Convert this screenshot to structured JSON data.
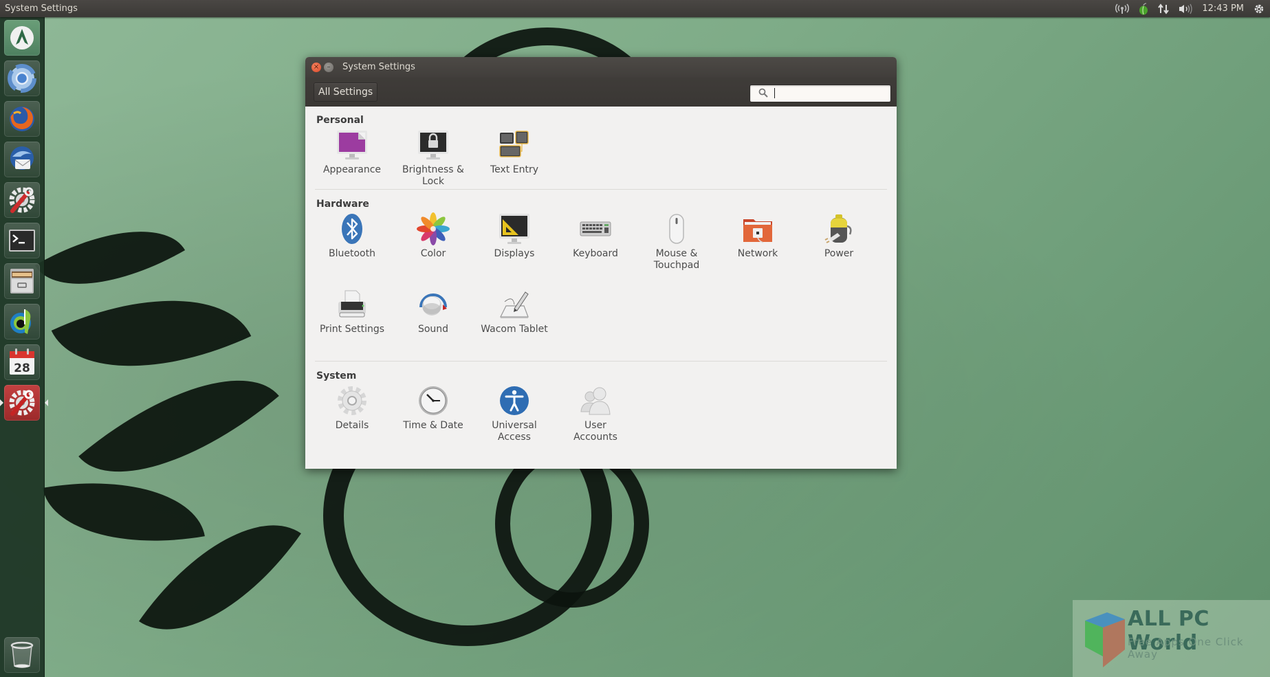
{
  "top_panel": {
    "app_title": "System Settings",
    "clock": "12:43 PM",
    "indicators": [
      {
        "name": "network-wireless",
        "icon": "wifi-icon"
      },
      {
        "name": "tor",
        "icon": "onion-icon"
      },
      {
        "name": "transfer",
        "icon": "up-down-arrows-icon"
      },
      {
        "name": "volume",
        "icon": "volume-icon"
      },
      {
        "name": "session",
        "icon": "power-gear-icon"
      }
    ]
  },
  "launcher": {
    "items": [
      {
        "name": "arch-launcher",
        "icon": "arch-logo-icon"
      },
      {
        "name": "chromium",
        "icon": "chromium-icon"
      },
      {
        "name": "firefox",
        "icon": "firefox-icon"
      },
      {
        "name": "thunderbird",
        "icon": "thunderbird-icon"
      },
      {
        "name": "system-tools",
        "icon": "settings-wrench-icon"
      },
      {
        "name": "terminal",
        "icon": "terminal-icon"
      },
      {
        "name": "file-manager",
        "icon": "file-cabinet-icon"
      },
      {
        "name": "music-player",
        "icon": "music-player-icon"
      },
      {
        "name": "calendar",
        "icon": "calendar-icon",
        "day": "28"
      },
      {
        "name": "system-settings",
        "icon": "settings-wrench-icon",
        "active": true
      },
      {
        "name": "trash",
        "icon": "trash-icon"
      }
    ]
  },
  "window": {
    "title": "System Settings",
    "all_settings_label": "All Settings",
    "search": {
      "value": "",
      "placeholder": ""
    },
    "sections": [
      {
        "title": "Personal",
        "items": [
          {
            "label": "Appearance",
            "icon": "appearance-icon"
          },
          {
            "label": "Brightness & Lock",
            "icon": "brightness-lock-icon"
          },
          {
            "label": "Text Entry",
            "icon": "text-entry-icon"
          }
        ]
      },
      {
        "title": "Hardware",
        "items": [
          {
            "label": "Bluetooth",
            "icon": "bluetooth-icon"
          },
          {
            "label": "Color",
            "icon": "color-icon"
          },
          {
            "label": "Displays",
            "icon": "displays-icon"
          },
          {
            "label": "Keyboard",
            "icon": "keyboard-icon"
          },
          {
            "label": "Mouse & Touchpad",
            "icon": "mouse-icon"
          },
          {
            "label": "Network",
            "icon": "network-icon"
          },
          {
            "label": "Power",
            "icon": "power-battery-icon"
          },
          {
            "label": "Print Settings",
            "icon": "printer-icon"
          },
          {
            "label": "Sound",
            "icon": "sound-icon"
          },
          {
            "label": "Wacom Tablet",
            "icon": "wacom-tablet-icon"
          }
        ]
      },
      {
        "title": "System",
        "items": [
          {
            "label": "Details",
            "icon": "details-gear-icon"
          },
          {
            "label": "Time & Date",
            "icon": "clock-icon"
          },
          {
            "label": "Universal Access",
            "icon": "universal-access-icon"
          },
          {
            "label": "User Accounts",
            "icon": "user-accounts-icon"
          }
        ]
      }
    ]
  },
  "watermark": {
    "title": "ALL PC World",
    "subtitle": "Free Apps One Click Away"
  },
  "colors": {
    "panel": "#3f3c39",
    "window_bg": "#f2f1f0",
    "close_button": "#e5532f",
    "desktop": "#7fac88",
    "launcher": "#1c3424"
  }
}
